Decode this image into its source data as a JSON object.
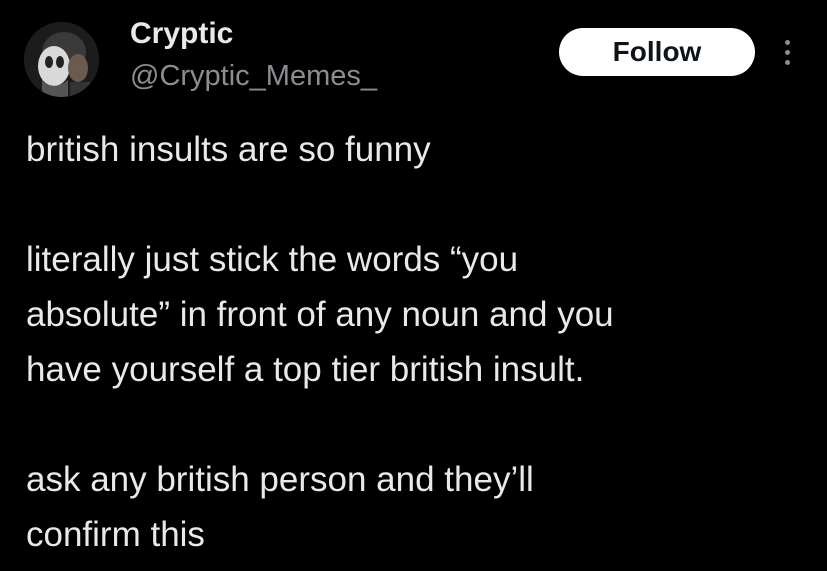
{
  "author": {
    "display_name": "Cryptic",
    "handle": "@Cryptic_Memes_"
  },
  "actions": {
    "follow_label": "Follow",
    "more_icon": "more-vertical-icon"
  },
  "tweet": {
    "line_1": "british insults are so funny",
    "paragraph_2_line_1": "literally just stick the words “you",
    "paragraph_2_line_2": "absolute” in front of any noun and you",
    "paragraph_2_line_3": "have yourself a top tier british insult.",
    "paragraph_3_line_1": "ask any british person and they’ll",
    "paragraph_3_line_2": "confirm this"
  },
  "colors": {
    "background": "#000000",
    "primary_text": "#e7e9ea",
    "secondary_text": "#8a8d91",
    "follow_bg": "#ffffff",
    "follow_text": "#0f1419"
  }
}
